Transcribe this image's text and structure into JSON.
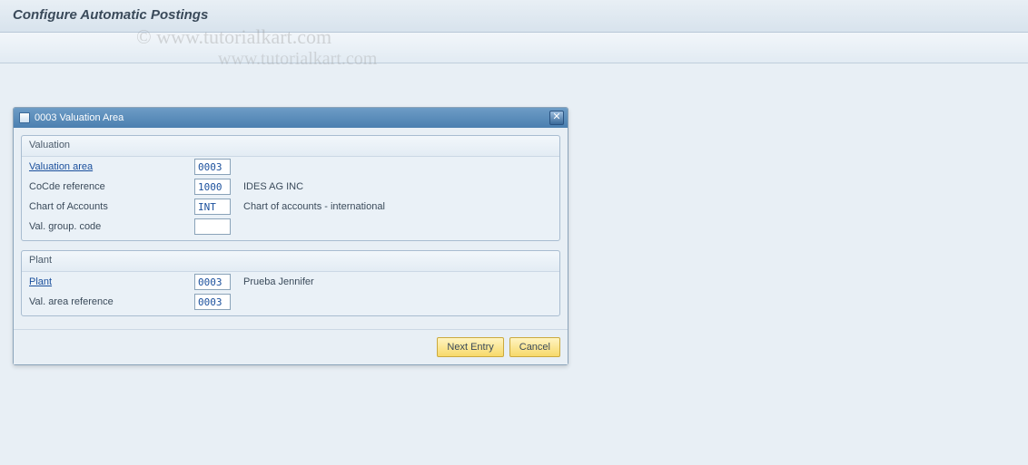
{
  "page": {
    "title": "Configure Automatic Postings"
  },
  "watermark": {
    "line1": "© www.tutorialkart.com",
    "line2": "www.tutorialkart.com"
  },
  "dialog": {
    "title": "0003 Valuation Area",
    "groups": {
      "valuation": {
        "legend": "Valuation",
        "fields": {
          "valuation_area": {
            "label": "Valuation area",
            "value": "0003",
            "desc": "",
            "link": true
          },
          "cocde_reference": {
            "label": "CoCde reference",
            "value": "1000",
            "desc": "IDES AG INC",
            "link": false
          },
          "chart_of_accounts": {
            "label": "Chart of Accounts",
            "value": "INT",
            "desc": "Chart of accounts - international",
            "link": false
          },
          "val_group_code": {
            "label": "Val. group. code",
            "value": "",
            "desc": "",
            "link": false
          }
        }
      },
      "plant": {
        "legend": "Plant",
        "fields": {
          "plant": {
            "label": "Plant",
            "value": "0003",
            "desc": "Prueba Jennifer",
            "link": true
          },
          "val_area_reference": {
            "label": "Val. area reference",
            "value": "0003",
            "desc": "",
            "link": false
          }
        }
      }
    },
    "buttons": {
      "next_entry": "Next Entry",
      "cancel": "Cancel"
    }
  }
}
